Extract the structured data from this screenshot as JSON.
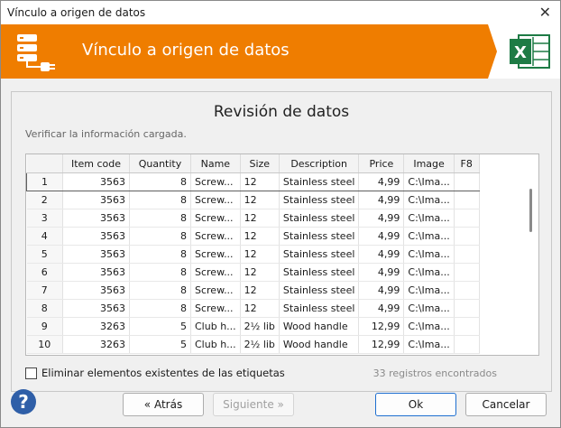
{
  "window": {
    "title": "Vínculo a origen de datos",
    "close_glyph": "✕"
  },
  "banner": {
    "title": "Vínculo a origen de datos",
    "icon": "database-link-icon",
    "app_icon": "excel-icon",
    "app_letter": "X",
    "color": "#ef7d00"
  },
  "panel": {
    "heading": "Revisión de datos",
    "subheading": "Verificar la información cargada."
  },
  "table": {
    "columns": [
      "",
      "Item code",
      "Quantity",
      "Name",
      "Size",
      "Description",
      "Price",
      "Image",
      "F8"
    ],
    "rows": [
      [
        "1",
        "3563",
        "8",
        "Screw...",
        "12",
        "Stainless steel",
        "4,99",
        "C:\\Ima...",
        ""
      ],
      [
        "2",
        "3563",
        "8",
        "Screw...",
        "12",
        "Stainless steel",
        "4,99",
        "C:\\Ima...",
        ""
      ],
      [
        "3",
        "3563",
        "8",
        "Screw...",
        "12",
        "Stainless steel",
        "4,99",
        "C:\\Ima...",
        ""
      ],
      [
        "4",
        "3563",
        "8",
        "Screw...",
        "12",
        "Stainless steel",
        "4,99",
        "C:\\Ima...",
        ""
      ],
      [
        "5",
        "3563",
        "8",
        "Screw...",
        "12",
        "Stainless steel",
        "4,99",
        "C:\\Ima...",
        ""
      ],
      [
        "6",
        "3563",
        "8",
        "Screw...",
        "12",
        "Stainless steel",
        "4,99",
        "C:\\Ima...",
        ""
      ],
      [
        "7",
        "3563",
        "8",
        "Screw...",
        "12",
        "Stainless steel",
        "4,99",
        "C:\\Ima...",
        ""
      ],
      [
        "8",
        "3563",
        "8",
        "Screw...",
        "12",
        "Stainless steel",
        "4,99",
        "C:\\Ima...",
        ""
      ],
      [
        "9",
        "3263",
        "5",
        "Club h...",
        "2½ lib",
        "Wood handle",
        "12,99",
        "C:\\Ima...",
        ""
      ],
      [
        "10",
        "3263",
        "5",
        "Club h...",
        "2½ lib",
        "Wood handle",
        "12,99",
        "C:\\Ima...",
        ""
      ]
    ],
    "selected_row": 0
  },
  "options": {
    "delete_existing_label": "Eliminar elementos existentes de las etiquetas",
    "delete_existing_checked": false
  },
  "status": {
    "count_text": "33 registros encontrados"
  },
  "footer": {
    "help_glyph": "?",
    "back_label": "« Atrás",
    "next_label": "Siguiente »",
    "ok_label": "Ok",
    "cancel_label": "Cancelar"
  }
}
